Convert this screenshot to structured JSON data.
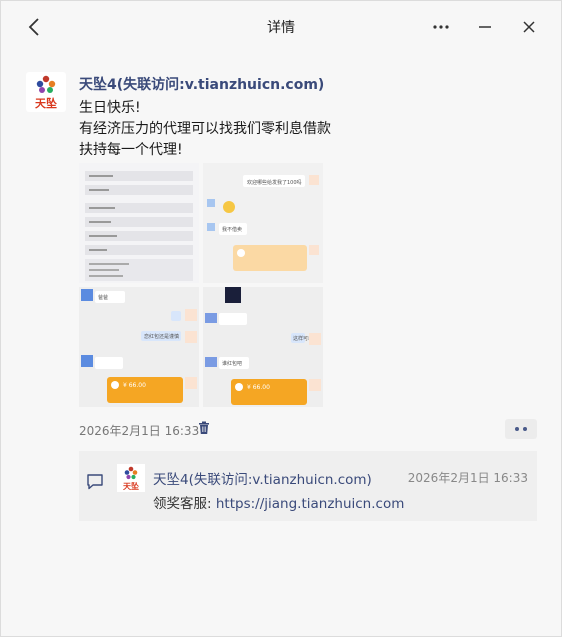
{
  "titlebar": {
    "title": "详情",
    "icons": {
      "back": "chevron-left-icon",
      "more": "more-horizontal-icon",
      "minimize": "minimize-icon",
      "close": "close-icon"
    }
  },
  "post": {
    "avatar_text": "天坠",
    "author": "天坠4(失联访问:v.tianzhuicn.com)",
    "content_lines": [
      "生日快乐!",
      "有经济压力的代理可以找我们零利息借款",
      "扶持每一个代理!"
    ],
    "images": [
      {
        "label": "settings-list-screenshot"
      },
      {
        "label": "chat-screenshot-1",
        "bubble_text": "欢迎哪些给发我了100吗",
        "reply": "我不借卖"
      },
      {
        "label": "chat-screenshot-2",
        "bubble_text": "爸爸",
        "reply": "恋红包还是谨慎",
        "amount": "¥ 66.00"
      },
      {
        "label": "chat-screenshot-3",
        "bubble_text": "这样可以",
        "reply": "谁红包吧",
        "amount": "¥ 66.00"
      }
    ],
    "timestamp": "2026年2月1日 16:33",
    "colors": {
      "accent": "#3a4a7a",
      "packet": "#f5a623"
    }
  },
  "comment": {
    "avatar_text": "天坠",
    "author": "天坠4(失联访问:v.tianzhuicn.com)",
    "time": "2026年2月1日 16:33",
    "prefix": "领奖客服:",
    "link": "https://jiang.tianzhuicn.com"
  }
}
